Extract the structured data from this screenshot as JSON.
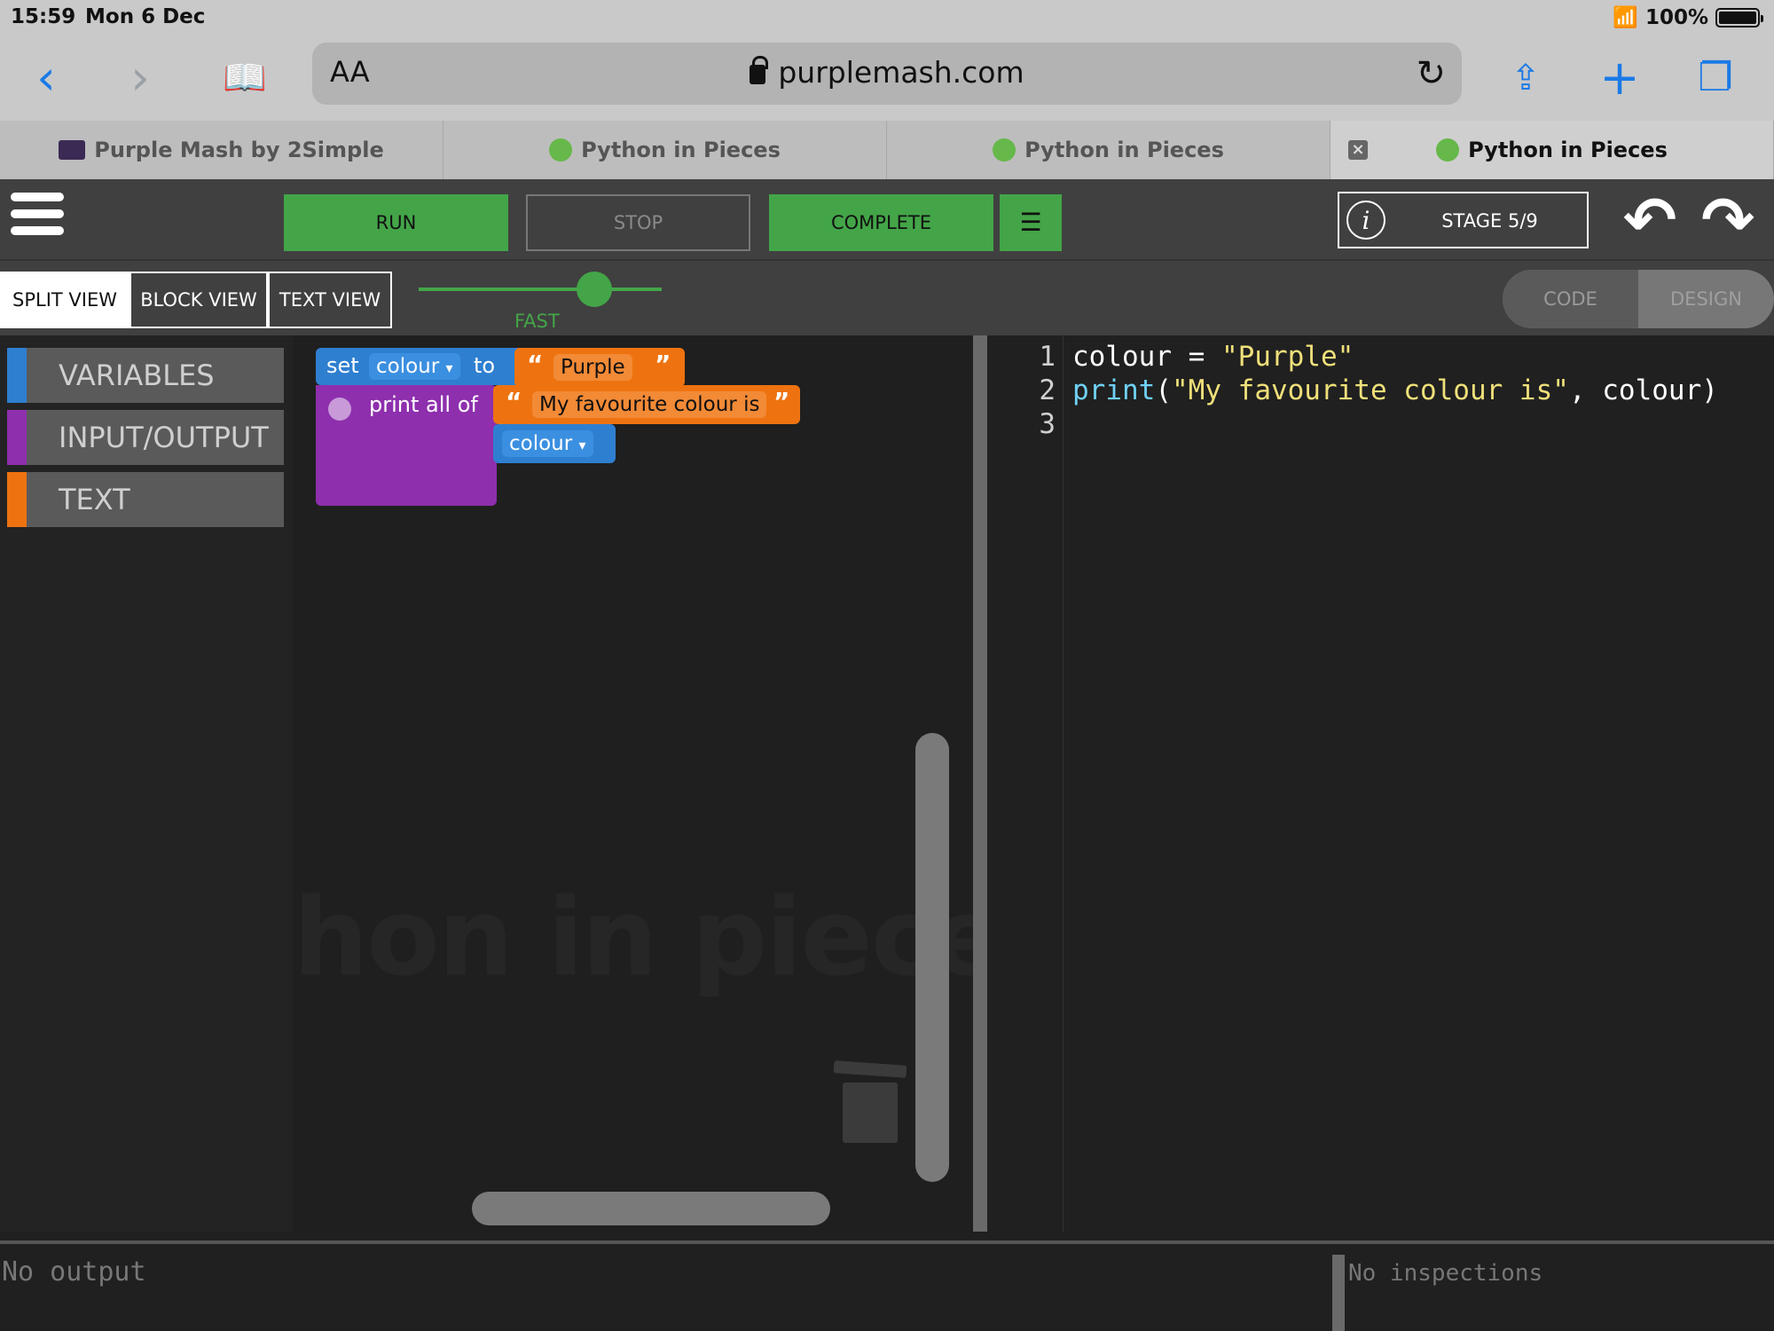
{
  "status_bar": {
    "time": "15:59",
    "date": "Mon 6 Dec",
    "battery": "100%"
  },
  "browser": {
    "address": {
      "aa": "AA",
      "url": "purplemash.com"
    },
    "tabs": [
      {
        "label": "Purple Mash by 2Simple"
      },
      {
        "label": "Python in Pieces"
      },
      {
        "label": "Python in Pieces"
      },
      {
        "label": "Python in Pieces",
        "active": true
      }
    ]
  },
  "app_bar": {
    "run_label": "RUN",
    "stop_label": "STOP",
    "complete_label": "COMPLETE",
    "stage_label": "STAGE 5/9"
  },
  "view_bar": {
    "split_label": "SPLIT VIEW",
    "block_label": "BLOCK VIEW",
    "text_label": "TEXT VIEW",
    "speed_label": "FAST",
    "code_label": "CODE",
    "design_label": "DESIGN"
  },
  "toolbox": [
    {
      "label": "VARIABLES",
      "color": "#2f7fd0"
    },
    {
      "label": "INPUT/OUTPUT",
      "color": "#8e2fae"
    },
    {
      "label": "TEXT",
      "color": "#ee7310"
    }
  ],
  "blocks": {
    "set_word": "set",
    "set_var": "colour",
    "to_word": "to",
    "set_value": "Purple",
    "print_label": "print all of",
    "print_string": "My favourite colour is",
    "print_var": "colour",
    "dropdown_arrow": "▾",
    "open_quote": "“",
    "close_quote": "”"
  },
  "workspace": {
    "watermark": "hon in pieces"
  },
  "code": {
    "line_numbers": [
      "1",
      "2",
      "3"
    ],
    "line1": {
      "name": "colour",
      "op": " = ",
      "value": "\"Purple\""
    },
    "line2": {
      "fn": "print",
      "open": "(",
      "string": "\"My favourite colour is\"",
      "rest": ", colour)"
    }
  },
  "output": {
    "text": "No output"
  },
  "inspections": {
    "text": "No inspections"
  }
}
